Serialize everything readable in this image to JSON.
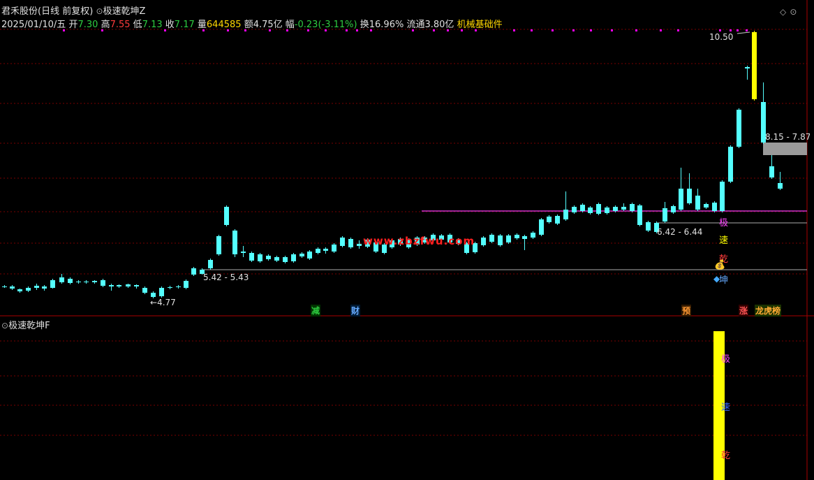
{
  "header": {
    "stock_name": "君禾股份",
    "period_info": "(日线 前复权)",
    "indicator_main": "极速乾坤Z",
    "date": "2025/01/10/五",
    "open_label": "开",
    "open": "7.30",
    "high_label": "高",
    "high": "7.55",
    "low_label": "低",
    "low": "7.13",
    "close_label": "收",
    "close": "7.17",
    "volume_label": "量",
    "volume": "644585",
    "amount_label": "额",
    "amount": "4.75亿",
    "change_label": "幅",
    "change": "-0.23(-3.11%)",
    "turnover_label": "换",
    "turnover": "16.96%",
    "float_label": "流通",
    "float_value": "3.80亿",
    "concept": "机械基础件"
  },
  "sub_panel": {
    "indicator_name": "极速乾坤F",
    "vertical_text": [
      "极",
      "速",
      "乾"
    ]
  },
  "watermark": "www.zbzfwu.com",
  "annotations": {
    "price_high": "10.50",
    "price_low": "4.77",
    "range_left": "5.42 - 5.43",
    "range_mid": "6.42 - 6.44",
    "range_right": "8.15 - 7.87"
  },
  "badges": {
    "jian": "减",
    "cai": "财",
    "yu": "预",
    "zhang": "涨",
    "longhu": "龙虎榜",
    "vertical": [
      "极",
      "速",
      "乾",
      "坤"
    ]
  },
  "colors": {
    "up": "#ff3b3b",
    "down": "#54ffff",
    "ma_line": "#cc33cc",
    "accent_yellow": "#ffff00",
    "grid": "#7a0000"
  }
}
